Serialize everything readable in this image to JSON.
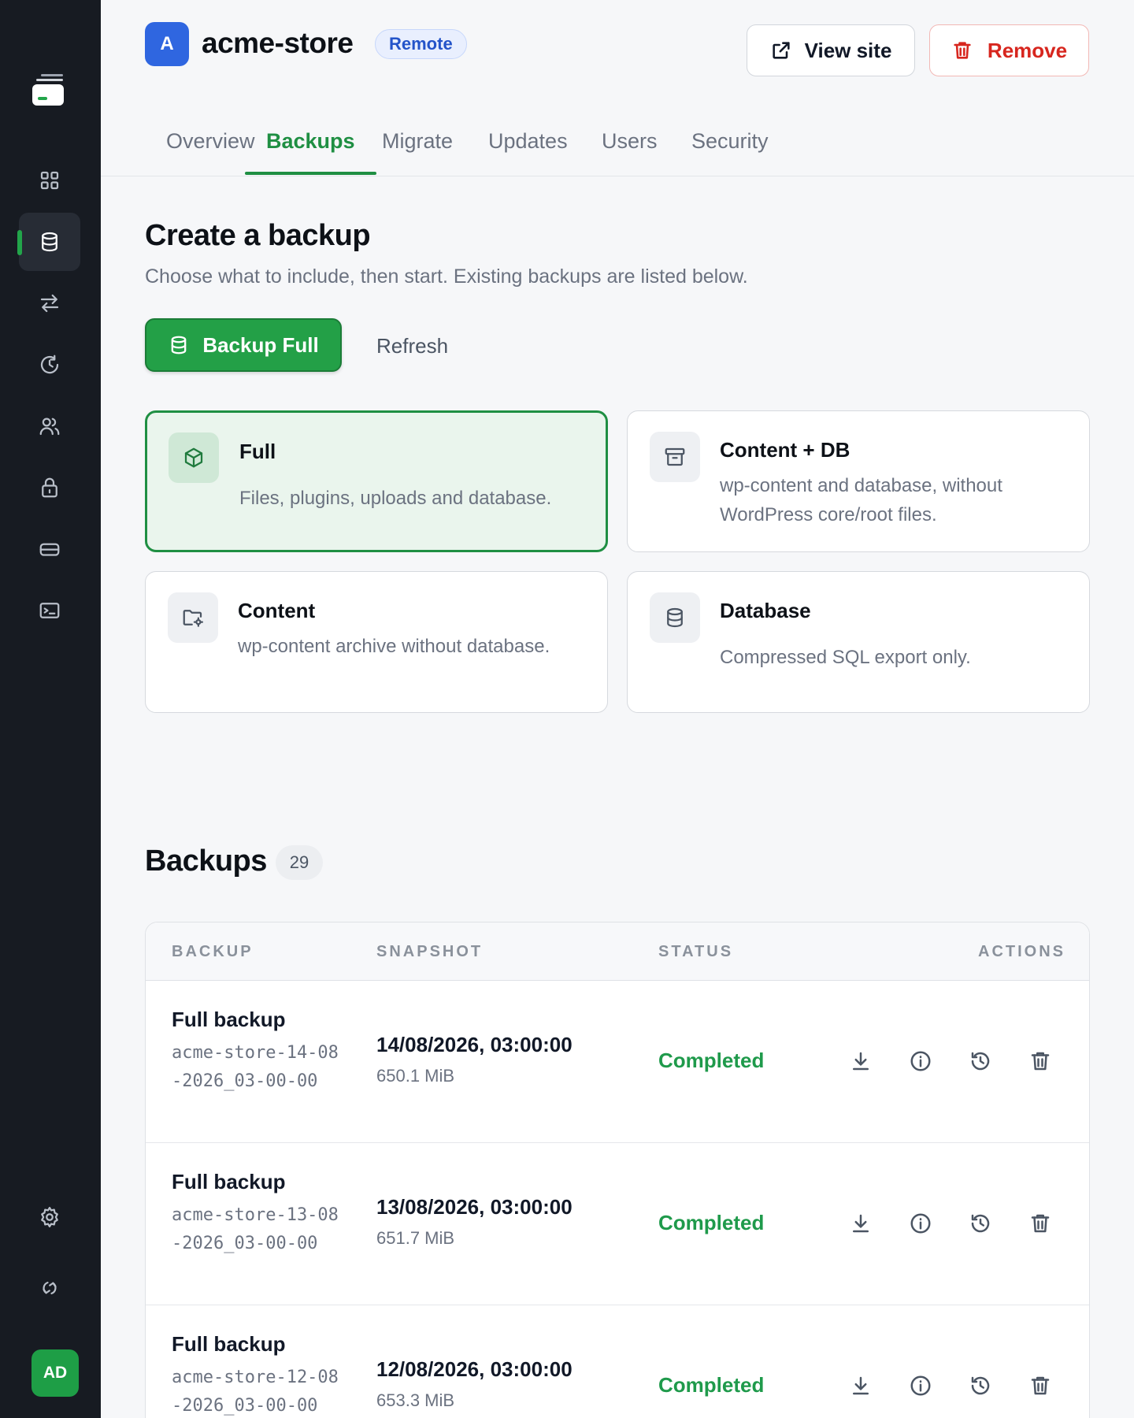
{
  "sidebar": {
    "nav": [
      "dashboard",
      "backups",
      "migrate",
      "updates",
      "users",
      "security",
      "billing",
      "terminal"
    ],
    "active": "backups",
    "bottom": [
      "settings",
      "sync"
    ],
    "user_initials": "AD"
  },
  "header": {
    "site_initial": "A",
    "site_name": "acme-store",
    "badge": "Remote",
    "view_site": "View site",
    "remove": "Remove"
  },
  "tabs": [
    "Overview",
    "Backups",
    "Migrate",
    "Updates",
    "Users",
    "Security"
  ],
  "active_tab": "Backups",
  "create": {
    "title": "Create a backup",
    "subtitle": "Choose what to include, then start. Existing backups are listed below.",
    "primary_button": "Backup Full",
    "refresh_button": "Refresh",
    "options": [
      {
        "title": "Full",
        "description": "Files, plugins, uploads and database.",
        "selected": true,
        "icon": "cube-icon"
      },
      {
        "title": "Content + DB",
        "description": "wp-content and database, without WordPress core/root files.",
        "selected": false,
        "icon": "archive-icon"
      },
      {
        "title": "Content",
        "description": "wp-content archive without database.",
        "selected": false,
        "icon": "folder-gear-icon"
      },
      {
        "title": "Database",
        "description": "Compressed SQL export only.",
        "selected": false,
        "icon": "database-icon"
      }
    ]
  },
  "backups": {
    "title": "Backups",
    "count": "29",
    "columns": [
      "BACKUP",
      "SNAPSHOT",
      "STATUS",
      "ACTIONS"
    ],
    "rows": [
      {
        "type": "Full backup",
        "id": "acme-store-14-08-2026_03-00-00",
        "date": "14/08/2026, 03:00:00",
        "size": "650.1 MiB",
        "status": "Completed"
      },
      {
        "type": "Full backup",
        "id": "acme-store-13-08-2026_03-00-00",
        "date": "13/08/2026, 03:00:00",
        "size": "651.7 MiB",
        "status": "Completed"
      },
      {
        "type": "Full backup",
        "id": "acme-store-12-08-2026_03-00-00",
        "date": "12/08/2026, 03:00:00",
        "size": "653.3 MiB",
        "status": "Completed"
      }
    ]
  },
  "colors": {
    "accent": "#1f8f43",
    "danger": "#d7261e",
    "sidebar": "#171b22"
  }
}
